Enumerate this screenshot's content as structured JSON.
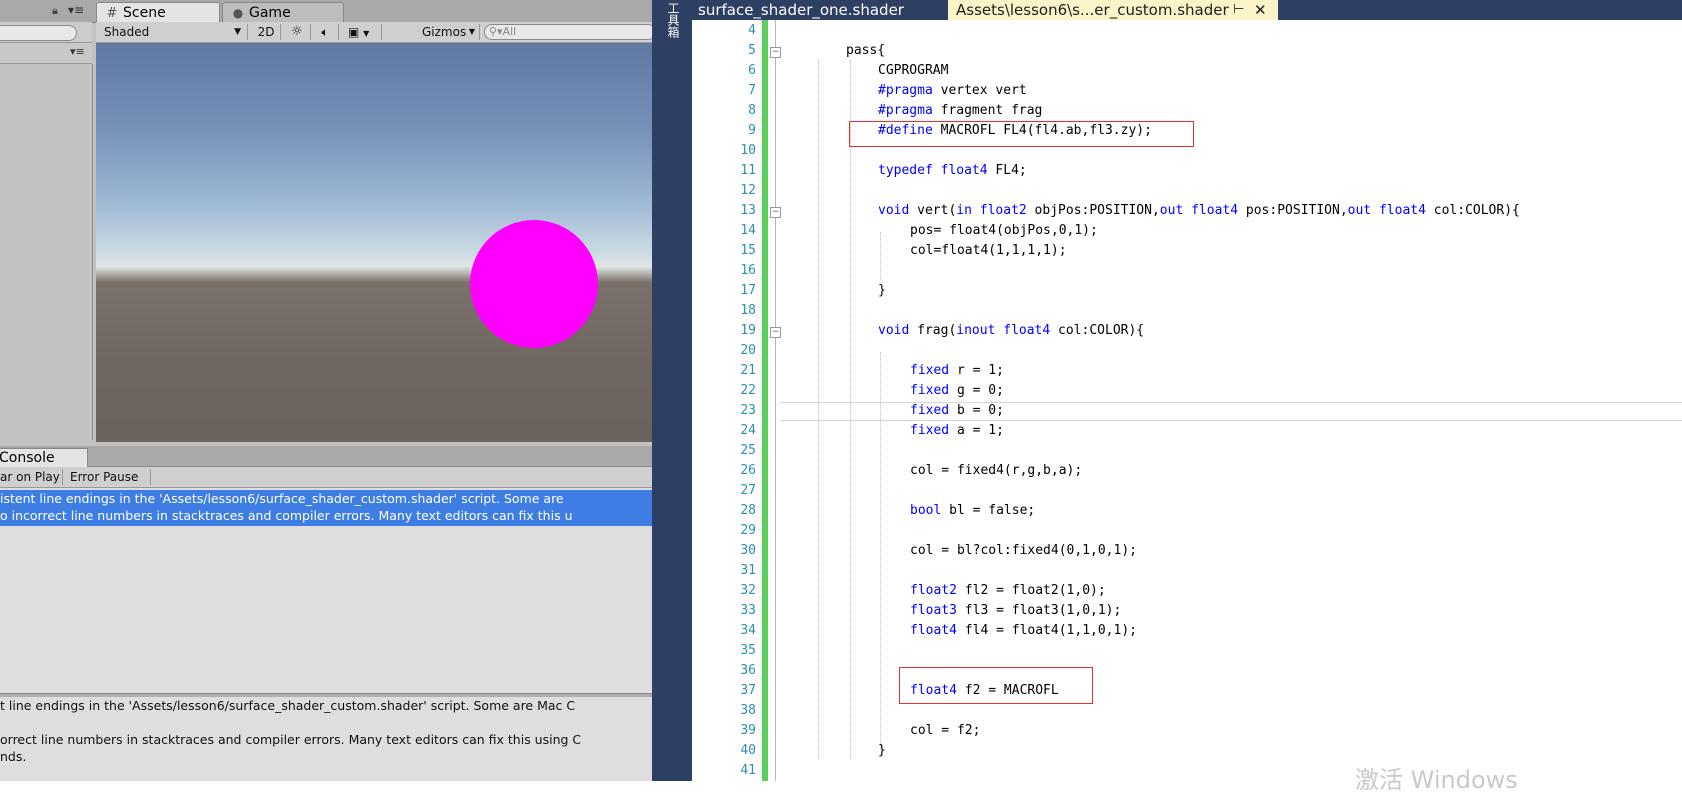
{
  "unity": {
    "tabs": {
      "scene": "Scene",
      "game": "Game"
    },
    "scene_toolbar": {
      "shading_mode": "Shaded",
      "mode_2d": "2D",
      "gizmos": "Gizmos",
      "search_placeholder": "All"
    },
    "sphere_color": "#ff00ff",
    "console": {
      "tab_label": "Console",
      "clear_on_play": "ar on Play",
      "error_pause": "Error Pause",
      "selected_message_line1": "istent line endings in the 'Assets/lesson6/surface_shader_custom.shader' script. Some are",
      "selected_message_line2": "o incorrect line numbers in stacktraces and compiler errors. Many text editors can fix this u",
      "detail_line1": "t line endings in the 'Assets/lesson6/surface_shader_custom.shader' script. Some are Mac C",
      "detail_line2": "",
      "detail_line3": "orrect line numbers in stacktraces and compiler errors. Many text editors can fix this using C",
      "detail_line4": "nds."
    },
    "selection_color": "#3e7de3"
  },
  "vs": {
    "side_strip_label": "工具箱",
    "tabs": [
      {
        "label": "surface_shader_one.shader"
      },
      {
        "label": "Assets\\lesson6\\s...er_custom.shader"
      }
    ],
    "active_tab_color": "#fcf4c9",
    "line_numbers": [
      "4",
      "5",
      "6",
      "7",
      "8",
      "9",
      "10",
      "11",
      "12",
      "13",
      "14",
      "15",
      "16",
      "17",
      "18",
      "19",
      "20",
      "21",
      "22",
      "23",
      "24",
      "25",
      "26",
      "27",
      "28",
      "29",
      "30",
      "31",
      "32",
      "33",
      "34",
      "35",
      "36",
      "37",
      "38",
      "39",
      "40",
      "41"
    ],
    "code": {
      "l5": "pass{",
      "l6": "CGPROGRAM",
      "l7_kw": "#pragma",
      "l7_rest": " vertex vert",
      "l8_kw": "#pragma",
      "l8_rest": " fragment frag",
      "l9_kw": "#define",
      "l9_rest": " MACROFL FL4(fl4.ab,fl3.zy);",
      "l11_kw1": "typedef",
      "l11_kw2": "float4",
      "l11_rest": " FL4;",
      "l13_kw1": "void",
      "l13_a": " vert(",
      "l13_kw2": "in",
      "l13_kw3": "float2",
      "l13_b": " objPos:POSITION,",
      "l13_kw4": "out",
      "l13_kw5": "float4",
      "l13_c": " pos:POSITION,",
      "l13_kw6": "out",
      "l13_kw7": "float4",
      "l13_d": " col:COLOR){",
      "l14": "pos= float4(objPos,0,1);",
      "l15": "col=float4(1,1,1,1);",
      "l17": "}",
      "l19_kw1": "void",
      "l19_a": " frag(",
      "l19_kw2": "inout",
      "l19_kw3": "float4",
      "l19_b": " col:COLOR){",
      "l21_kw": "fixed",
      "l21_rest": " r = 1;",
      "l22_kw": "fixed",
      "l22_rest": " g = 0;",
      "l23_kw": "fixed",
      "l23_rest": " b = 0;",
      "l24_kw": "fixed",
      "l24_rest": " a = 1;",
      "l26": "col = fixed4(r,g,b,a);",
      "l28_kw": "bool",
      "l28_rest": " bl = false;",
      "l30": "col = bl?col:fixed4(0,1,0,1);",
      "l32_kw": "float2",
      "l32_rest": " fl2 = float2(1,0);",
      "l33_kw": "float3",
      "l33_rest": " fl3 = float3(1,0,1);",
      "l34_kw": "float4",
      "l34_rest": " fl4 = float4(1,1,0,1);",
      "l37_kw": "float4",
      "l37_rest": " f2 = MACROFL",
      "l39": "col = f2;",
      "l40": "}"
    },
    "watermark": "激活 Windows",
    "highlight_color": "#e8312f"
  }
}
